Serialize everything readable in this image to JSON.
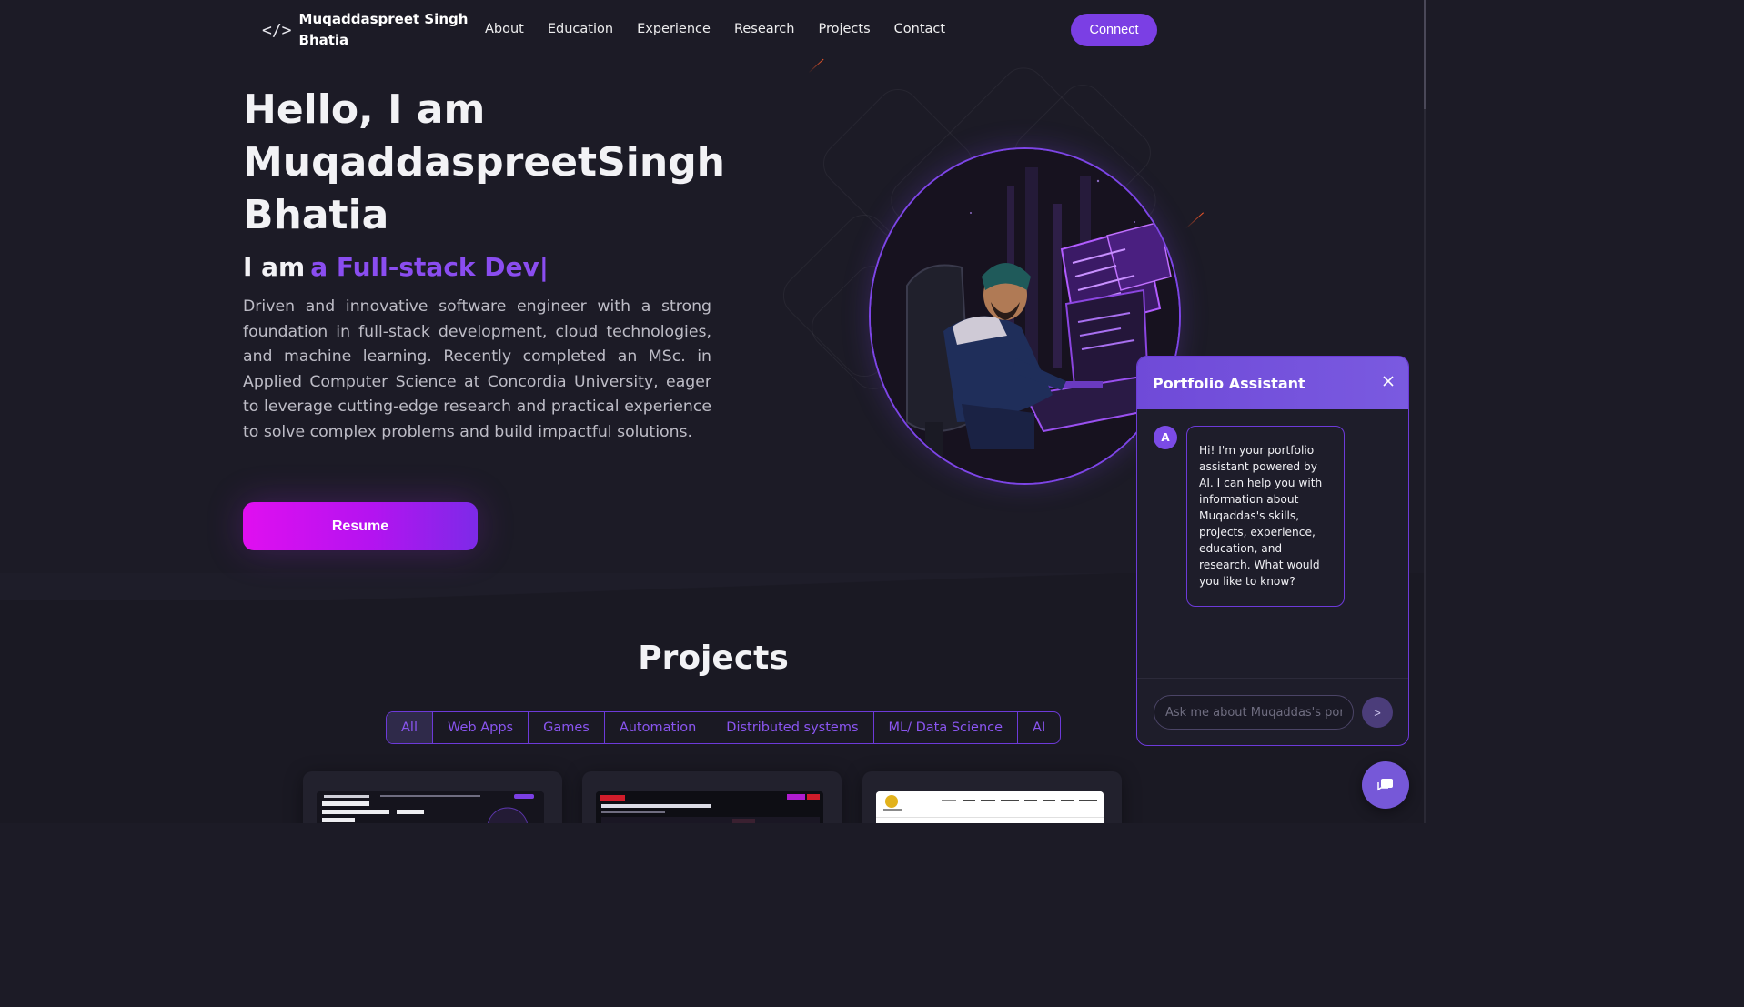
{
  "nav": {
    "logo_name": "Muqaddaspreet Singh Bhatia",
    "links": [
      "About",
      "Education",
      "Experience",
      "Research",
      "Projects",
      "Contact"
    ],
    "connect_label": "Connect"
  },
  "hero": {
    "greeting": "Hello, I am",
    "name_first": "Muqaddaspreet",
    "name_middle": "Singh",
    "name_last": "Bhatia",
    "role_prefix": "I am",
    "role_typed": "a Full-stack Dev",
    "role_cursor": "|",
    "description": "Driven and innovative software engineer with a strong foundation in full-stack development, cloud technologies, and machine learning. Recently completed an MSc. in Applied Computer Science at Concordia University, eager to leverage cutting-edge research and practical experience to solve complex problems and build impactful solutions.",
    "resume_label": "Resume"
  },
  "projects": {
    "title": "Projects",
    "filters": [
      "All",
      "Web Apps",
      "Games",
      "Automation",
      "Distributed systems",
      "ML/ Data Science",
      "AI"
    ],
    "active_filter": "All"
  },
  "chat": {
    "title": "Portfolio Assistant",
    "avatar_letter": "A",
    "message": "Hi! I'm your portfolio assistant powered by AI. I can help you with information about Muqaddas's skills, projects, experience, education, and research. What would you like to know?",
    "input_placeholder": "Ask me about Muqaddas's portfolio...",
    "send_glyph": ">"
  },
  "colors": {
    "background": "#1c1b26",
    "accent": "#7b3fe4",
    "role_text": "#8a4df0",
    "resume_gradient_start": "#e00ff0",
    "resume_gradient_end": "#7d2ae8"
  },
  "icons": {
    "logo": "code-brackets-icon",
    "chat_close": "close-icon",
    "chat_send": "send-icon",
    "chat_fab": "chat-bubble-icon"
  }
}
